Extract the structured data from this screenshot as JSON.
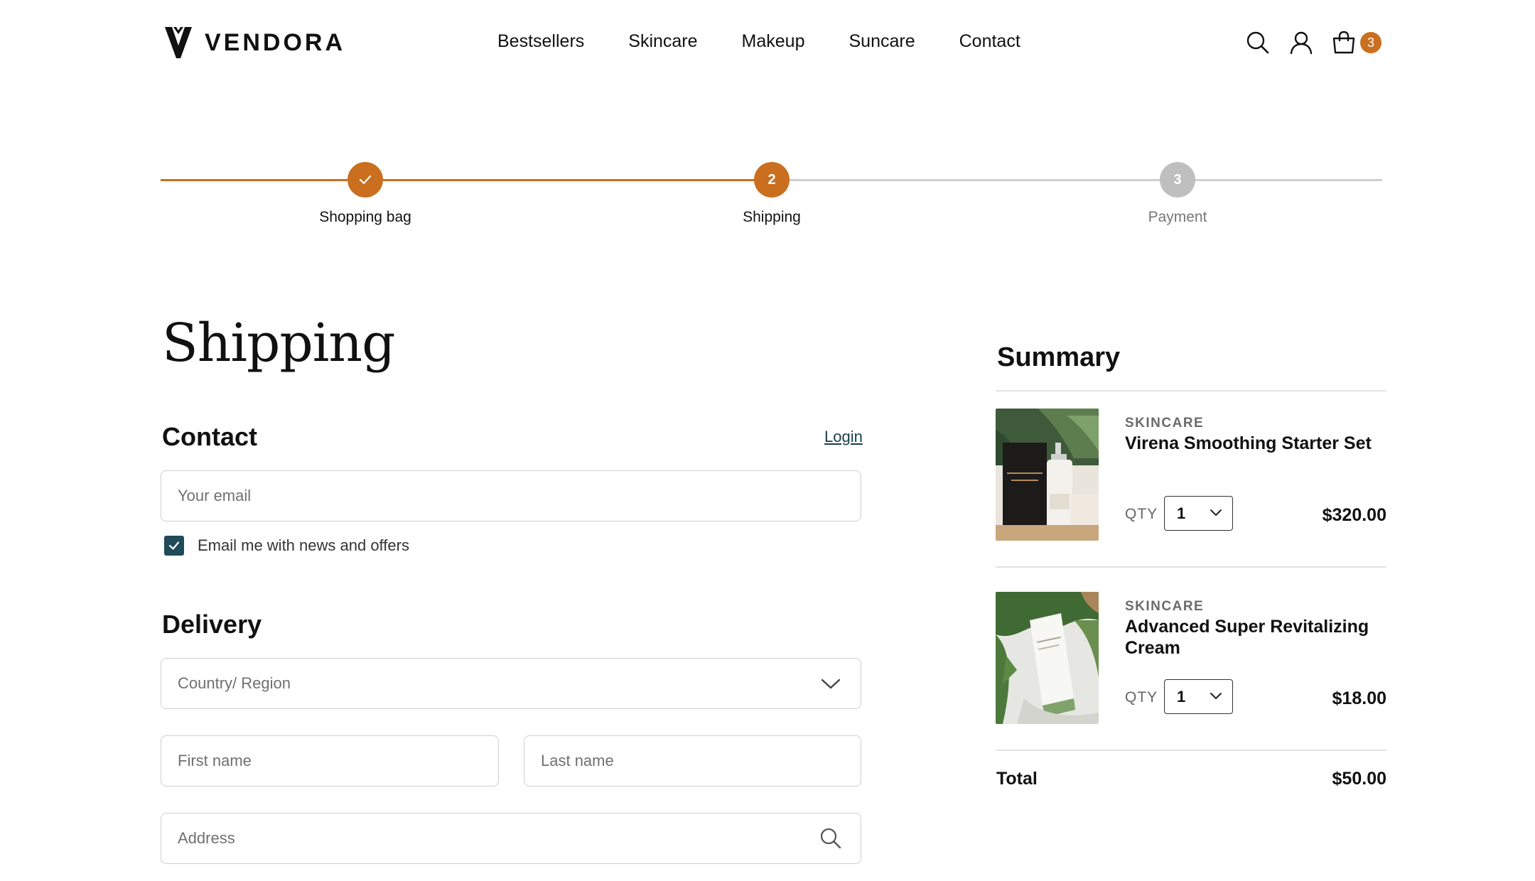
{
  "brand": {
    "name": "VENDORA"
  },
  "nav": {
    "items": [
      "Bestsellers",
      "Skincare",
      "Makeup",
      "Suncare",
      "Contact"
    ]
  },
  "header_icons": {
    "search": "search-icon",
    "account": "user-icon",
    "cart": "shopping-bag-icon",
    "cart_count": "3"
  },
  "stepper": {
    "steps": [
      {
        "label": "Shopping bag",
        "number": "1",
        "state": "completed"
      },
      {
        "label": "Shipping",
        "number": "2",
        "state": "active"
      },
      {
        "label": "Payment",
        "number": "3",
        "state": "pending"
      }
    ],
    "progress": 0.5
  },
  "page": {
    "title": "Shipping"
  },
  "contact": {
    "title": "Contact",
    "login_label": "Login",
    "email_placeholder": "Your email",
    "newsletter_label": "Email me with news and offers",
    "newsletter_checked": true
  },
  "delivery": {
    "title": "Delivery",
    "country_placeholder": "Country/ Region",
    "first_name_placeholder": "First name",
    "last_name_placeholder": "Last name",
    "address_placeholder": "Address"
  },
  "summary": {
    "title": "Summary",
    "qty_label": "QTY",
    "items": [
      {
        "category": "SKINCARE",
        "name": "Virena Smoothing Starter Set",
        "qty": "1",
        "price": "$320.00"
      },
      {
        "category": "SKINCARE",
        "name": "Advanced Super Revitalizing Cream",
        "qty": "1",
        "price": "$18.00"
      }
    ],
    "total_label": "Total",
    "total_value": "$50.00"
  },
  "colors": {
    "accent": "#c96f1f",
    "checkbox": "#1f4a57",
    "link": "#1a3e4c",
    "pending": "#bfbfbf"
  }
}
